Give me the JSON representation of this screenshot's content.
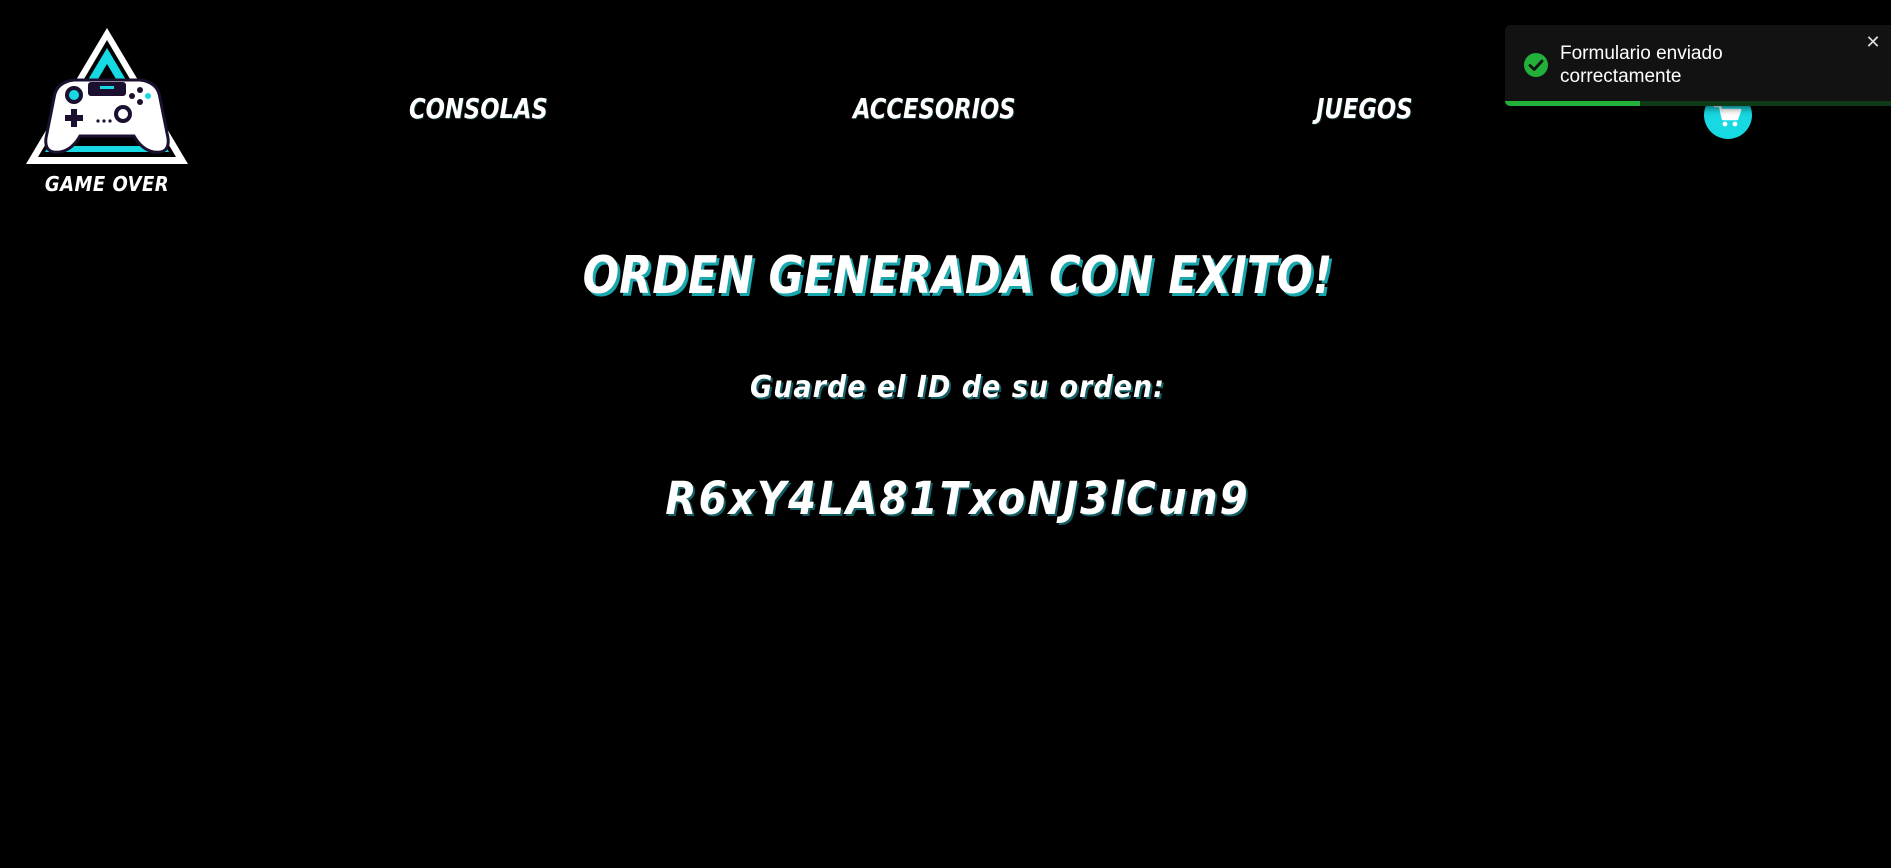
{
  "brand": {
    "name": "GAME OVER"
  },
  "nav": {
    "items": [
      {
        "label": "CONSOLAS"
      },
      {
        "label": "ACCESORIOS"
      },
      {
        "label": "JUEGOS"
      }
    ],
    "cart_icon": "shopping-cart-icon"
  },
  "main": {
    "title": "ORDEN GENERADA CON EXITO!",
    "subtitle": "Guarde el ID de su orden:",
    "order_id": "R6xY4LA81TxoNJ3lCun9"
  },
  "toast": {
    "message": "Formulario enviado correctamente",
    "status_icon": "check-circle-icon",
    "close_icon": "close-icon",
    "close_symbol": "✕",
    "progress": 0.35
  },
  "colors": {
    "background": "#000000",
    "accent": "#17d9e3",
    "toast_background": "#121212",
    "success": "#23b03a"
  }
}
